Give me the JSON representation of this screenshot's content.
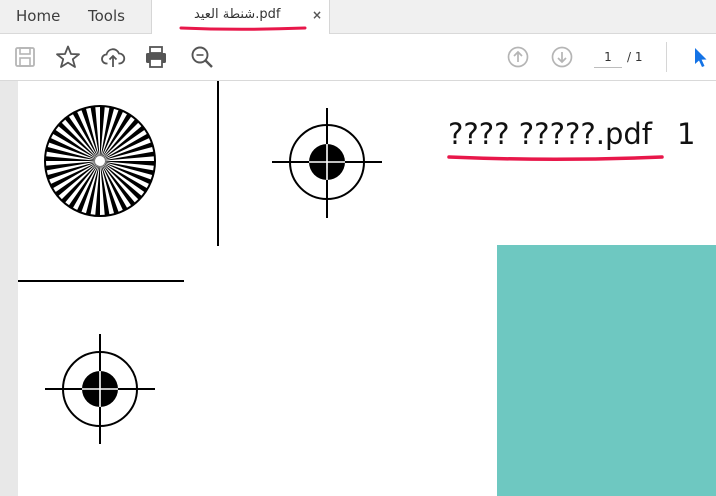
{
  "tabs": {
    "home_label": "Home",
    "tools_label": "Tools",
    "document_title": "شنطة العيد.pdf",
    "close_glyph": "×"
  },
  "toolbar": {
    "save_icon": "save-icon",
    "bookmark_icon": "star-icon",
    "upload_icon": "cloud-upload-icon",
    "print_icon": "print-icon",
    "zoom_icon": "zoom-icon",
    "prev_page_icon": "arrow-up-circle-icon",
    "next_page_icon": "arrow-down-circle-icon",
    "select_icon": "pointer-icon",
    "current_page": "1",
    "page_total": "/ 1"
  },
  "document": {
    "heading": "???? ?????.pdf",
    "page_number": "1"
  },
  "colors": {
    "teal_block": "#6ec8c1",
    "annotation_red": "#e8174a",
    "pointer_blue": "#1473e6"
  }
}
